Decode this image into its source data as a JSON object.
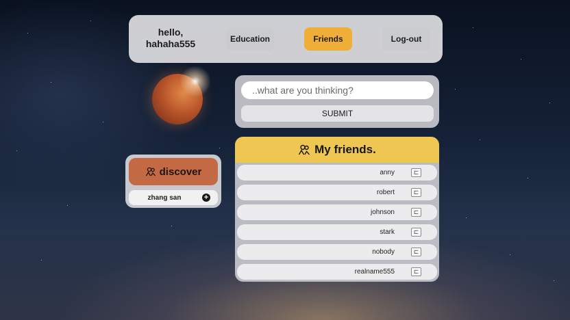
{
  "header": {
    "greeting_line1": "hello,",
    "greeting_line2": "hahaha555",
    "nav": {
      "education": "Education",
      "friends": "Friends",
      "logout": "Log-out"
    }
  },
  "composer": {
    "placeholder": "..what are you thinking?",
    "submit": "SUBMIT"
  },
  "discover": {
    "title": "discover",
    "icon": "users-icon",
    "user": "zhang san",
    "add_icon": "plus-circle-icon"
  },
  "friends": {
    "title": "My friends.",
    "icon": "users-icon",
    "action_icon": "message-icon",
    "list": [
      "anny",
      "robert",
      "johnson",
      "stark",
      "nobody",
      "realname555"
    ]
  },
  "colors": {
    "friends_nav_active": "#efae37",
    "friends_header": "#f0c653",
    "discover_button": "#c36a45"
  }
}
